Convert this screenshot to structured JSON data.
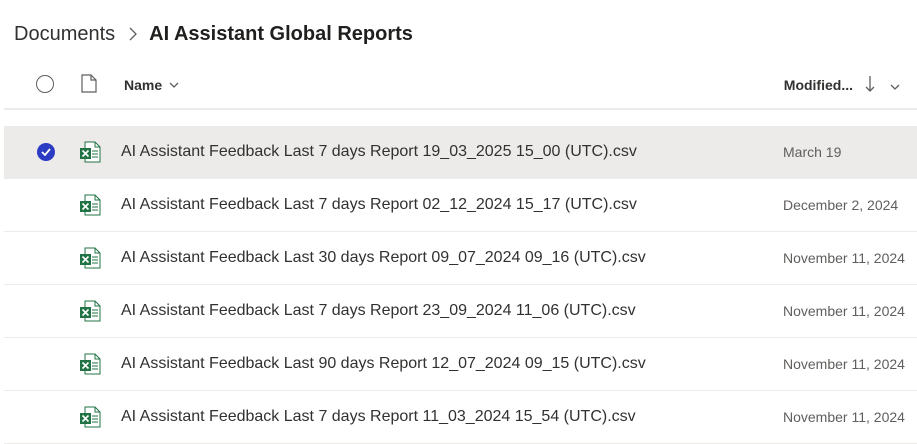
{
  "breadcrumb": {
    "parent": "Documents",
    "current": "AI Assistant Global Reports"
  },
  "header": {
    "name_label": "Name",
    "modified_label": "Modified..."
  },
  "colors": {
    "selected_row": "#edebe9",
    "check_fill": "#2b3bc4",
    "excel_green": "#217346"
  },
  "files": [
    {
      "name": "AI Assistant Feedback Last 7 days Report 19_03_2025 15_00 (UTC).csv",
      "modified": "March 19",
      "selected": true,
      "icon": "excel-csv-icon"
    },
    {
      "name": "AI Assistant Feedback Last 7 days Report 02_12_2024 15_17 (UTC).csv",
      "modified": "December 2, 2024",
      "selected": false,
      "icon": "excel-csv-icon"
    },
    {
      "name": "AI Assistant Feedback Last 30 days Report 09_07_2024 09_16 (UTC).csv",
      "modified": "November 11, 2024",
      "selected": false,
      "icon": "excel-csv-icon"
    },
    {
      "name": "AI Assistant Feedback Last 7 days Report 23_09_2024 11_06 (UTC).csv",
      "modified": "November 11, 2024",
      "selected": false,
      "icon": "excel-csv-icon"
    },
    {
      "name": "AI Assistant Feedback Last 90 days Report 12_07_2024 09_15 (UTC).csv",
      "modified": "November 11, 2024",
      "selected": false,
      "icon": "excel-csv-icon"
    },
    {
      "name": "AI Assistant Feedback Last 7 days Report 11_03_2024 15_54 (UTC).csv",
      "modified": "November 11, 2024",
      "selected": false,
      "icon": "excel-csv-icon"
    }
  ]
}
